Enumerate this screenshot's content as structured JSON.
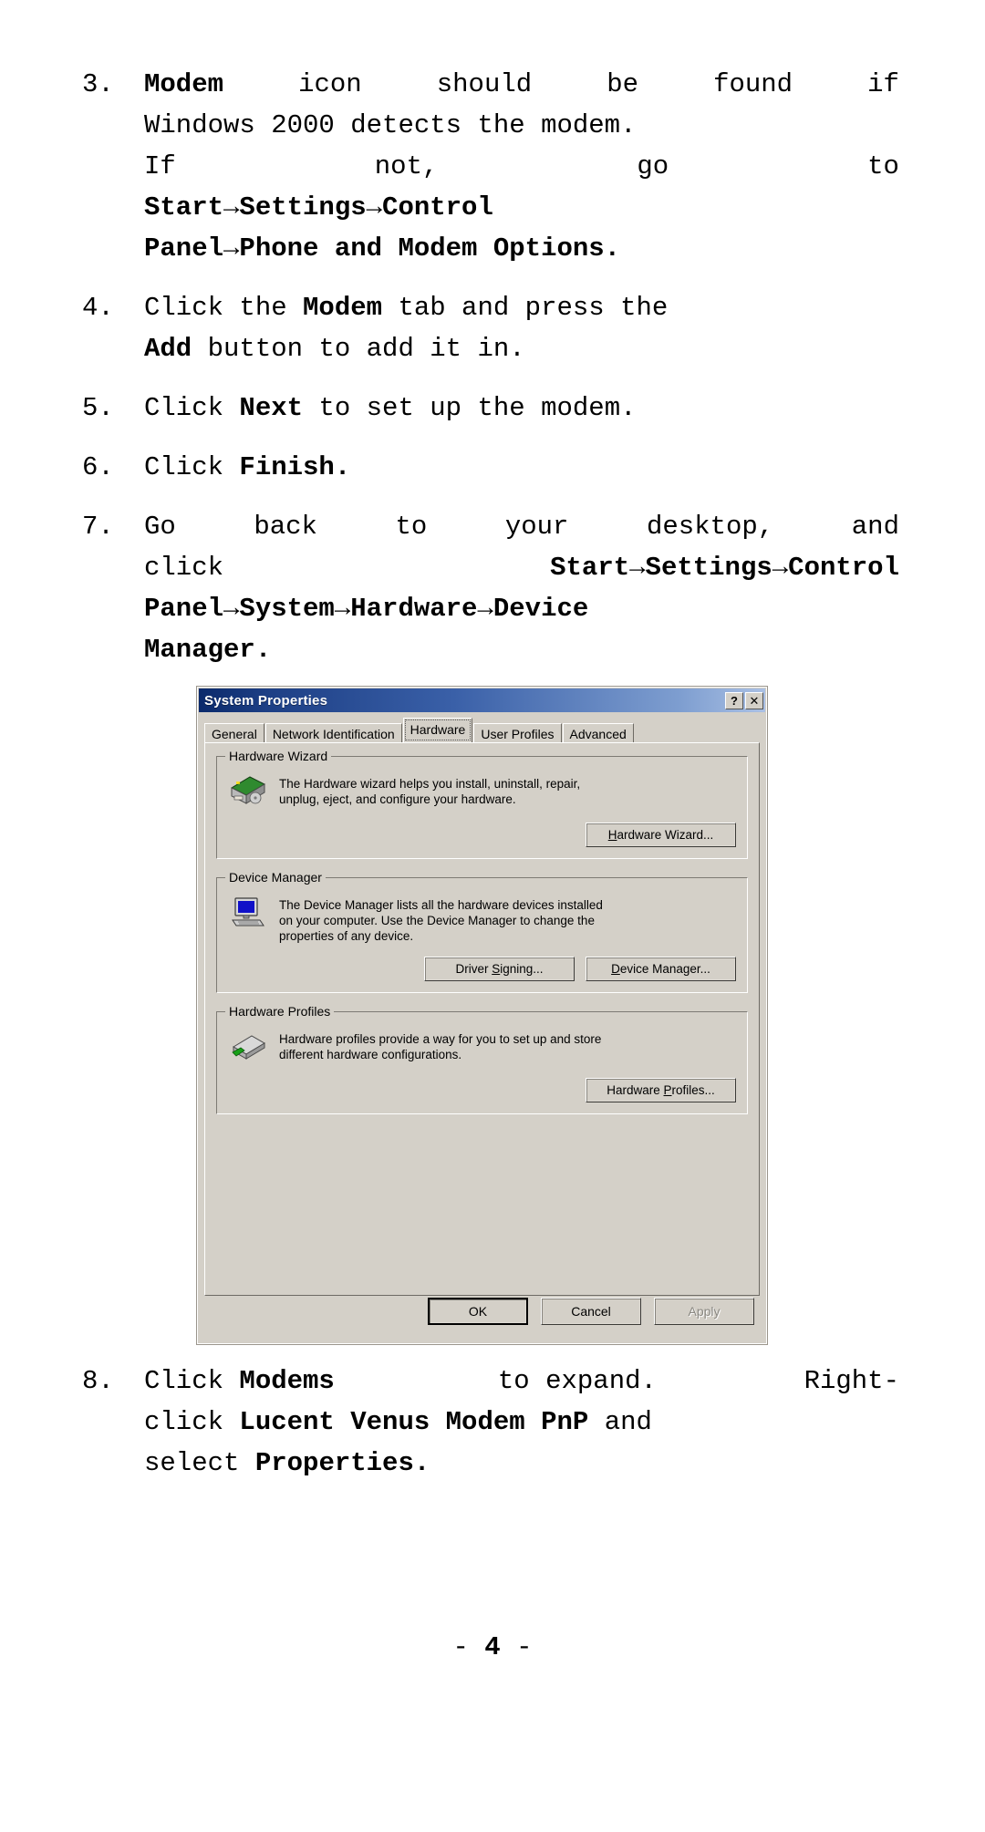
{
  "document": {
    "page_number": "- 4 -",
    "page_number_prefix": "-",
    "page_number_value": "4",
    "page_number_suffix": "-"
  },
  "steps": [
    {
      "number": "3.",
      "lines": [
        [
          {
            "t": "Modem",
            "b": true
          },
          {
            "t": " icon should be found if",
            "b": false
          }
        ],
        [
          {
            "t": "Windows 2000 detects the modem.",
            "b": false
          }
        ],
        [
          {
            "t": "If not, go to",
            "b": false
          }
        ],
        [
          {
            "t": "Start",
            "b": true
          },
          {
            "t": "→",
            "b": true,
            "arrow": true
          },
          {
            "t": "Settings",
            "b": true
          },
          {
            "t": "→",
            "b": true,
            "arrow": true
          },
          {
            "t": "Control",
            "b": true
          }
        ],
        [
          {
            "t": "Panel",
            "b": true
          },
          {
            "t": "→",
            "b": true,
            "arrow": true
          },
          {
            "t": "Phone and Modem Options.",
            "b": true
          }
        ]
      ]
    },
    {
      "number": "4.",
      "lines": [
        [
          {
            "t": "Click the ",
            "b": false
          },
          {
            "t": "Modem",
            "b": true
          },
          {
            "t": " tab and press the",
            "b": false
          }
        ],
        [
          {
            "t": "Add",
            "b": true
          },
          {
            "t": " button to add it in.",
            "b": false
          }
        ]
      ]
    },
    {
      "number": "5.",
      "lines": [
        [
          {
            "t": "Click ",
            "b": false
          },
          {
            "t": "Next",
            "b": true
          },
          {
            "t": " to set up the modem.",
            "b": false
          }
        ]
      ]
    },
    {
      "number": "6.",
      "lines": [
        [
          {
            "t": "Click ",
            "b": false
          },
          {
            "t": "Finish.",
            "b": true
          }
        ]
      ]
    },
    {
      "number": "7.",
      "lines": [
        [
          {
            "t": "Go back to your desktop, and",
            "b": false
          }
        ],
        [
          {
            "t": "click ",
            "b": false
          },
          {
            "t": "Start",
            "b": true
          },
          {
            "t": "→",
            "b": true,
            "arrow": true
          },
          {
            "t": "Settings",
            "b": true
          },
          {
            "t": "→",
            "b": true,
            "arrow": true
          },
          {
            "t": "Control",
            "b": true
          }
        ],
        [
          {
            "t": "Panel",
            "b": true
          },
          {
            "t": "→",
            "b": true,
            "arrow": true
          },
          {
            "t": "System",
            "b": true
          },
          {
            "t": "→",
            "b": true,
            "arrow": true
          },
          {
            "t": "Hardware",
            "b": true
          },
          {
            "t": "→",
            "b": true,
            "arrow": true
          },
          {
            "t": "Device",
            "b": true
          }
        ],
        [
          {
            "t": "Manager.",
            "b": true
          }
        ]
      ]
    },
    {
      "number": "8.",
      "lines": [
        [
          {
            "t": "Click ",
            "b": false
          },
          {
            "t": "Modems",
            "b": true
          },
          {
            "t": " to expand. Right-",
            "b": false
          }
        ],
        [
          {
            "t": "click ",
            "b": false
          },
          {
            "t": "Lucent Venus Modem PnP",
            "b": true
          },
          {
            "t": " and",
            "b": false
          }
        ],
        [
          {
            "t": "select ",
            "b": false
          },
          {
            "t": "Properties.",
            "b": true
          }
        ]
      ]
    }
  ],
  "step3": {
    "l1_a": "3.",
    "l1_bold": "Modem",
    "l1_w1": "icon",
    "l1_w2": "should",
    "l1_w3": "be",
    "l1_w4": "found",
    "l1_w5": "if",
    "l2": "Windows 2000 detects the modem.",
    "l3_w1": "If",
    "l3_w2": "not,",
    "l3_w3": "go",
    "l3_w4": "to",
    "l4": "Start→Settings→Control",
    "l5": "Panel→Phone and Modem Options."
  },
  "step4": {
    "num": "4.",
    "t1": "Click the ",
    "b1": "Modem",
    "t2": " tab and press the",
    "b2": "Add",
    "t3": " button to add it in."
  },
  "step5": {
    "num": "5.",
    "t1": "Click ",
    "b1": "Next",
    "t2": " to set up the modem."
  },
  "step6": {
    "num": "6.",
    "t1": "Click ",
    "b1": "Finish."
  },
  "step7": {
    "num": "7.",
    "l1_w1": "Go",
    "l1_w2": "back",
    "l1_w3": "to",
    "l1_w4": "your",
    "l1_w5": "desktop,",
    "l1_w6": "and",
    "l2_w1": "click",
    "l2_b": "Start→Settings→Control",
    "l3": "Panel→System→Hardware→Device",
    "l4": "Manager."
  },
  "step8": {
    "num": "8.",
    "l1_t1": "Click ",
    "l1_b": "Modems",
    "l1_t2": " to expand.",
    "l1_t3": "Right-",
    "l2_t1": "click ",
    "l2_b": "Lucent Venus Modem PnP",
    "l2_t2": " and",
    "l3_t1": "select ",
    "l3_b": "Properties."
  },
  "dialog": {
    "title": "System Properties",
    "help_button": "?",
    "close_button": "✕",
    "tabs": [
      {
        "label": "General",
        "selected": false
      },
      {
        "label": "Network Identification",
        "selected": false
      },
      {
        "label": "Hardware",
        "selected": true
      },
      {
        "label": "User Profiles",
        "selected": false
      },
      {
        "label": "Advanced",
        "selected": false
      }
    ],
    "groups": [
      {
        "legend": "Hardware Wizard",
        "icon": "hardware-card-icon",
        "text": "The Hardware wizard helps you install, uninstall, repair, unplug, eject, and configure your hardware.",
        "text_line1": "The Hardware wizard helps you install, uninstall, repair,",
        "text_line2": "unplug, eject, and configure your hardware.",
        "buttons": [
          {
            "label": "Hardware Wizard...",
            "mnemonic": "H",
            "disabled": false
          }
        ]
      },
      {
        "legend": "Device Manager",
        "icon": "computer-monitor-icon",
        "text": "The Device Manager lists all the hardware devices installed on your computer. Use the Device Manager to change the properties of any device.",
        "text_line1": "The Device Manager lists all the hardware devices installed",
        "text_line2": "on your computer. Use the Device Manager to change the",
        "text_line3": "properties of any device.",
        "buttons": [
          {
            "label": "Driver Signing...",
            "mnemonic": "S",
            "disabled": false
          },
          {
            "label": "Device Manager...",
            "mnemonic": "D",
            "disabled": false
          }
        ]
      },
      {
        "legend": "Hardware Profiles",
        "icon": "hardware-profiles-icon",
        "text": "Hardware profiles provide a way for you to set up and store different hardware configurations.",
        "text_line1": "Hardware profiles provide a way for you to set up and store",
        "text_line2": "different hardware configurations.",
        "buttons": [
          {
            "label": "Hardware Profiles...",
            "mnemonic": "P",
            "disabled": false
          }
        ]
      }
    ],
    "footer_buttons": [
      {
        "label": "OK",
        "default": true,
        "disabled": false
      },
      {
        "label": "Cancel",
        "default": false,
        "disabled": false
      },
      {
        "label": "Apply",
        "default": false,
        "disabled": true
      }
    ]
  },
  "colors": {
    "dialog_face": "#d4d0c8",
    "titlebar_start": "#0b2a6b",
    "titlebar_end": "#aac0e4",
    "page_background": "#ffffff",
    "text": "#000000",
    "disabled_text": "#868481"
  }
}
